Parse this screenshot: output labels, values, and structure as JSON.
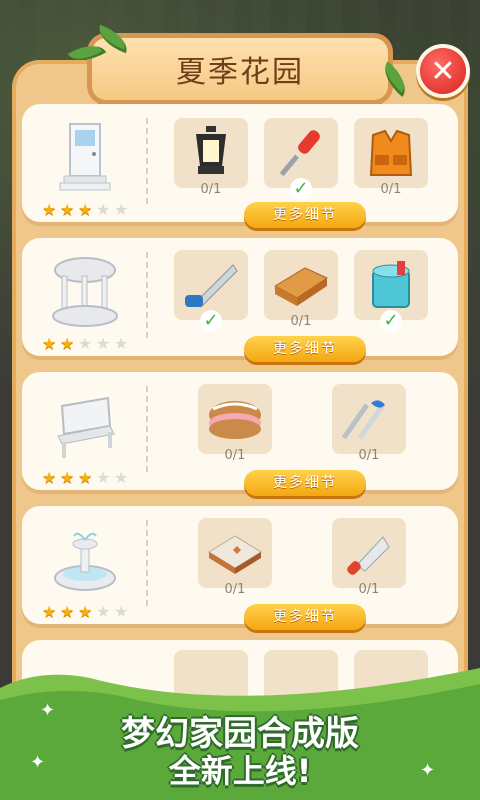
{
  "title": "夏季花园",
  "close_label": "✕",
  "cards": [
    {
      "name": "door",
      "stars": 3,
      "details": "更多细节",
      "items": [
        {
          "name": "lantern",
          "count": "0/1",
          "done": false
        },
        {
          "name": "screwdriver",
          "count": "",
          "done": true
        },
        {
          "name": "vest",
          "count": "0/1",
          "done": false
        }
      ]
    },
    {
      "name": "gazebo",
      "stars": 2,
      "details": "更多细节",
      "items": [
        {
          "name": "saw",
          "count": "",
          "done": true
        },
        {
          "name": "wood-planks",
          "count": "0/1",
          "done": false
        },
        {
          "name": "paint-bucket",
          "count": "",
          "done": true
        }
      ]
    },
    {
      "name": "bench",
      "stars": 3,
      "details": "更多细节",
      "items": [
        {
          "name": "cake",
          "count": "0/1",
          "done": false
        },
        {
          "name": "cutlery",
          "count": "0/1",
          "done": false
        }
      ]
    },
    {
      "name": "fountain",
      "stars": 3,
      "details": "更多细节",
      "items": [
        {
          "name": "tiles",
          "count": "0/1",
          "done": false
        },
        {
          "name": "trowel",
          "count": "0/1",
          "done": false
        }
      ]
    }
  ],
  "banner": {
    "line1": "梦幻家园合成版",
    "line2": "全新上线!"
  }
}
